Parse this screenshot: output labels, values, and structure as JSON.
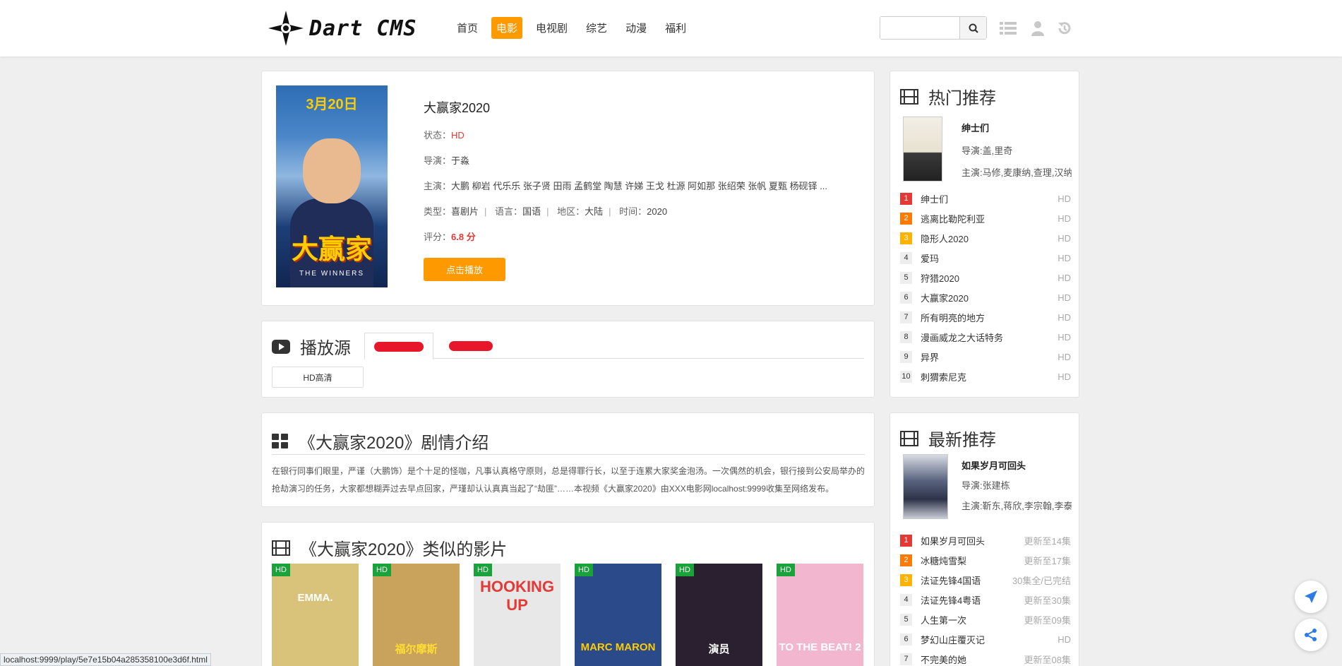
{
  "header": {
    "logo_text": "Dart CMS",
    "nav": [
      "首页",
      "电影",
      "电视剧",
      "综艺",
      "动漫",
      "福利"
    ],
    "active_nav": "电影",
    "search_placeholder": ""
  },
  "detail": {
    "poster_date": "3月20日",
    "poster_title": "大赢家",
    "poster_sub": "THE WINNERS",
    "title": "大赢家2020",
    "status_label": "状态：",
    "status": "HD",
    "director_label": "导演：",
    "director": "于淼",
    "cast_label": "主演：",
    "cast": "大鹏 柳岩 代乐乐 张子贤 田雨 孟鹤堂 陶慧 许娣 王戈 杜源 阿如那 张绍荣 张帆 夏甄 杨砚铎 ...",
    "genre_label": "类型：",
    "genre": "喜剧片",
    "lang_label": "语言：",
    "lang": "国语",
    "region_label": "地区：",
    "region": "大陆",
    "time_label": "时间：",
    "time": "2020",
    "score_label": "评分：",
    "score": "6.8 分",
    "play_button": "点击播放"
  },
  "source": {
    "title": "播放源",
    "episode": "HD高清"
  },
  "plot": {
    "title": "《大赢家2020》剧情介绍",
    "text": "在银行同事们眼里，严谨（大鹏饰）是个十足的怪咖，凡事认真格守原则，总是得罪行长，以至于连累大家奖金泡汤。一次偶然的机会，银行接到公安局举办的抢劫演习的任务，大家都想糊弄过去早点回家，严瑾却认认真真当起了“劫匪”……本视频《大赢家2020》由XXX电影网localhost:9999收集至网络发布。"
  },
  "similar": {
    "title": "《大赢家2020》类似的影片",
    "badge": "HD",
    "films": [
      {
        "title": "EMMA.",
        "bg": "#d9c37a",
        "fg": "#ffffff"
      },
      {
        "title": "福尔摩斯",
        "bg": "#c9a25b",
        "fg": "#ffdd33"
      },
      {
        "title": "HOOKING UP",
        "bg": "#e8e8e8",
        "fg": "#e53935"
      },
      {
        "title": "MARC MARON",
        "bg": "#2b4a8a",
        "fg": "#ffcc00"
      },
      {
        "title": "演员",
        "bg": "#2a2030",
        "fg": "#ffffff"
      },
      {
        "title": "TO THE BEAT! 2",
        "bg": "#f3b6cf",
        "fg": "#ffffff"
      }
    ]
  },
  "hot": {
    "title": "热门推荐",
    "feat_name": "绅士们",
    "feat_director": "导演:盖,里奇",
    "feat_cast": "主演:马修,麦康纳,查理,汉纳姆",
    "items": [
      {
        "name": "绅士们",
        "status": "HD"
      },
      {
        "name": "逃离比勒陀利亚",
        "status": "HD"
      },
      {
        "name": "隐形人2020",
        "status": "HD"
      },
      {
        "name": "爱玛",
        "status": "HD"
      },
      {
        "name": "狩猎2020",
        "status": "HD"
      },
      {
        "name": "大赢家2020",
        "status": "HD"
      },
      {
        "name": "所有明亮的地方",
        "status": "HD"
      },
      {
        "name": "漫画威龙之大话特务",
        "status": "HD"
      },
      {
        "name": "异界",
        "status": "HD"
      },
      {
        "name": "刺猬索尼克",
        "status": "HD"
      }
    ]
  },
  "new": {
    "title": "最新推荐",
    "feat_name": "如果岁月可回头",
    "feat_director": "导演:张建栋",
    "feat_cast": "主演:靳东,蒋欣,李宗翰,李泰",
    "items": [
      {
        "name": "如果岁月可回头",
        "status": "更新至14集"
      },
      {
        "name": "冰糖炖雪梨",
        "status": "更新至17集"
      },
      {
        "name": "法证先锋4国语",
        "status": "30集全/已完结"
      },
      {
        "name": "法证先锋4粤语",
        "status": "更新至30集"
      },
      {
        "name": "人生第一次",
        "status": "更新至09集"
      },
      {
        "name": "梦幻山庄覆灭记",
        "status": "HD"
      },
      {
        "name": "不完美的她",
        "status": "更新至08集"
      }
    ]
  },
  "status_bar": "localhost:9999/play/5e7e15b04a285358100e3d6f.html",
  "colors": {
    "accent": "#ff9900",
    "hd_badge": "#1aa33a",
    "red": "#e53935"
  }
}
